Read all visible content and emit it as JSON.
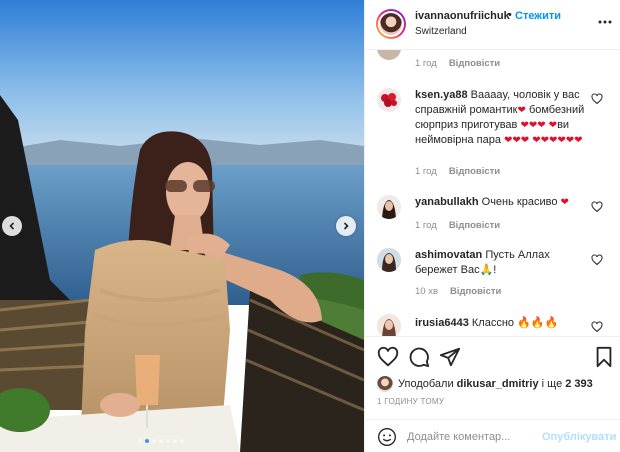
{
  "header": {
    "username": "ivannaonufriichuk",
    "separator": "•",
    "follow_label": "Стежити",
    "location": "Switzerland",
    "more_icon": "more-horizontal-icon"
  },
  "comments": [
    {
      "time": "1 год",
      "reply_label": "Відповісти"
    },
    {
      "username": "ksen.ya88",
      "text": "Вааааy, чоловік у вас справжній романтик",
      "text2": "бомбезний сюрприз приготував",
      "text3": "ви неймовірна пара",
      "time": "1 год",
      "reply_label": "Відповісти"
    },
    {
      "username": "yanabullakh",
      "text": "Очень красиво",
      "time": "1 год",
      "reply_label": "Відповісти"
    },
    {
      "username": "ashimovatan",
      "text": "Пусть Аллах бережет Вас",
      "text_end": "!",
      "time": "10 хв",
      "reply_label": "Відповісти"
    },
    {
      "username": "irusia6443",
      "text": "Классно"
    }
  ],
  "likes": {
    "prefix": "Уподобали",
    "user": "dikusar_dmitriy",
    "middle": "і ще",
    "count": "2 393"
  },
  "post_time": "1 ГОДИНУ ТОМУ",
  "add_comment": {
    "placeholder": "Додайте коментар...",
    "post_label": "Опублікувати"
  },
  "carousel": {
    "dots": 7,
    "active_dot": 1
  },
  "colors": {
    "accent": "#0095f6",
    "heart": "#e0102a",
    "muted": "#8e8e8e",
    "post_disabled": "#b2dffc"
  }
}
